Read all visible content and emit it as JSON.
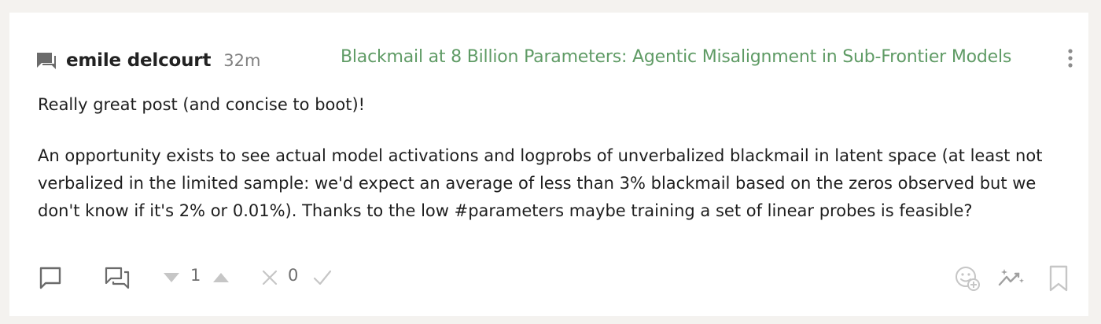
{
  "comment": {
    "author": "emile delcourt",
    "time": "32m",
    "post_title": "Blackmail at 8 Billion Parameters: Agentic Misalignment in Sub-Frontier Models",
    "paragraphs": [
      "Really great post (and concise to boot)!",
      "An opportunity exists to see actual model activations and logprobs of unverbalized blackmail in latent space (at least not verbalized in the limited sample: we'd expect an average of less than 3% blackmail based on the zeros observed but we don't know if it's 2% or 0.01%). Thanks to the low #parameters maybe training a set of linear probes is feasible?"
    ]
  },
  "votes": {
    "karma": "1",
    "agreement": "0"
  },
  "icons": {
    "header": [
      "comment-icon",
      "more-menu-icon"
    ],
    "footer_left": [
      "reply-icon",
      "thread-icon",
      "downvote-icon",
      "upvote-icon",
      "disagree-icon",
      "agree-icon"
    ],
    "footer_right": [
      "add-reaction-icon",
      "sparkle-trend-icon",
      "bookmark-icon"
    ]
  },
  "colors": {
    "link": "#5f9b65",
    "icon": "#9a9a9a",
    "background": "#f4f2ef"
  }
}
